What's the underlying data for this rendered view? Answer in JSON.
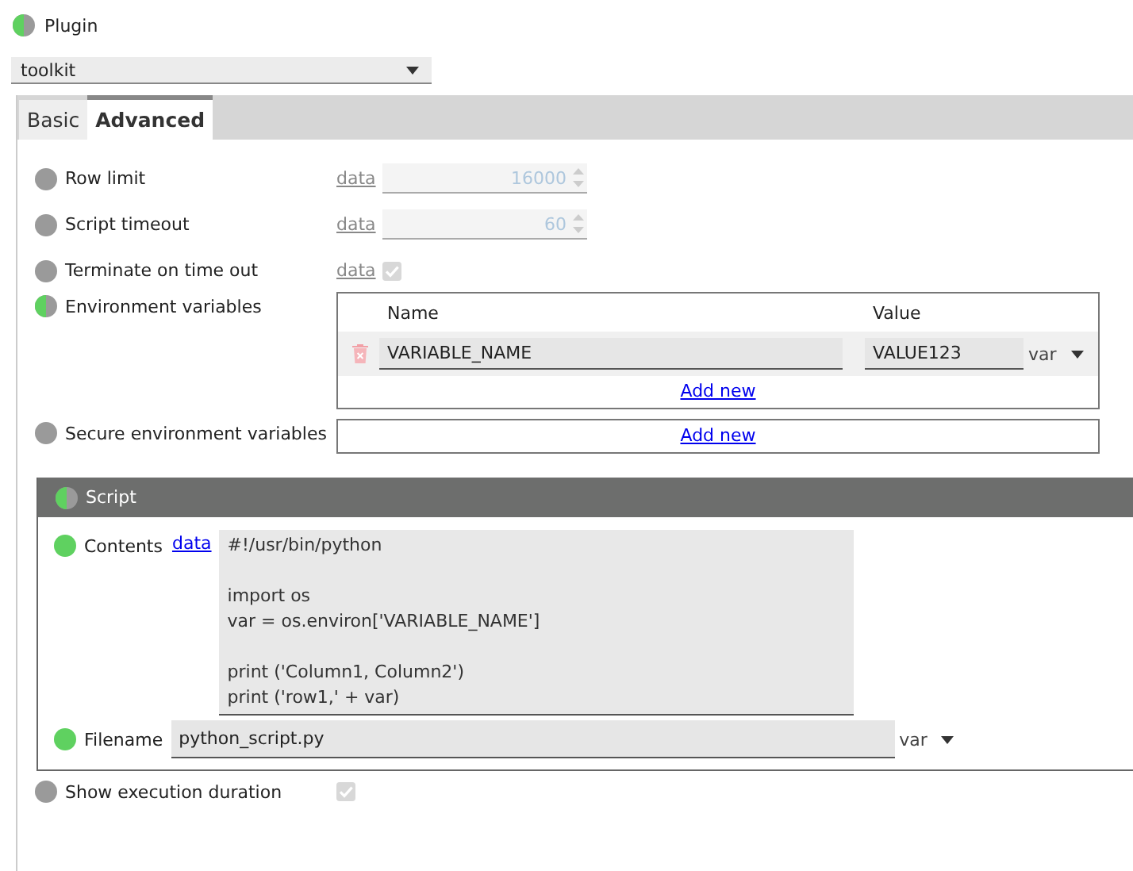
{
  "plugin": {
    "level": 0.5,
    "label": "Plugin"
  },
  "plugin_select": {
    "value": "toolkit"
  },
  "tabs": [
    {
      "label": "Basic",
      "selected": false
    },
    {
      "label": "Advanced",
      "selected": true
    }
  ],
  "fields": [
    {
      "kind": "number",
      "level": 0,
      "label": "Row limit",
      "link": "data",
      "value": "16000",
      "disabled": true
    },
    {
      "kind": "number",
      "level": 0,
      "label": "Script timeout",
      "link": "data",
      "value": "60",
      "disabled": true
    },
    {
      "kind": "checkbox",
      "level": 0,
      "label": "Terminate on time out",
      "link": "data",
      "checked": true,
      "disabled": true
    },
    {
      "kind": "table",
      "level": 0.5,
      "label": "Environment variables",
      "columns": [
        "Name",
        "Value"
      ],
      "rows": [
        {
          "name": "VARIABLE_NAME",
          "value": "VALUE123",
          "type": "var"
        }
      ],
      "add_link": "Add new"
    },
    {
      "kind": "table",
      "level": 0,
      "label": "Secure environment variables",
      "add_link": "Add new"
    }
  ],
  "script": {
    "level": 0.5,
    "title": "Script",
    "contents": {
      "level": 1,
      "label": "Contents",
      "link": "data",
      "value": "#!/usr/bin/python\n\nimport os\nvar = os.environ['VARIABLE_NAME']\n\nprint ('Column1, Column2')\nprint ('row1,' + var)"
    },
    "filename": {
      "level": 1,
      "label": "Filename",
      "value": "python_script.py",
      "type": "var"
    }
  },
  "show_duration": {
    "level": 0,
    "label": "Show execution duration",
    "checked": true,
    "disabled": true
  }
}
